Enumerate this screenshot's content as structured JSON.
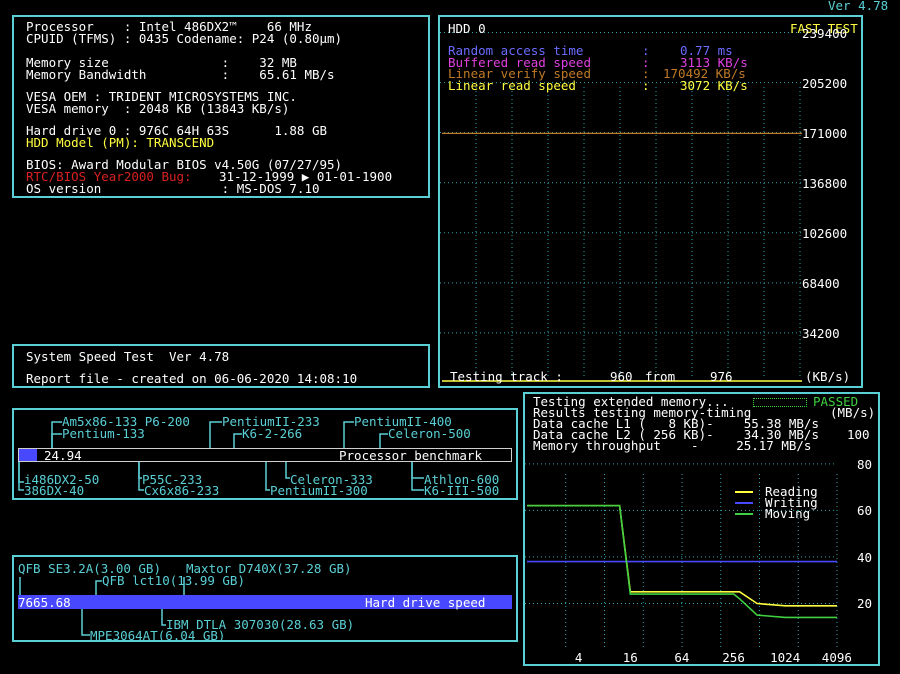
{
  "version": "Ver 4.78",
  "sysinfo": {
    "lines": [
      {
        "text": "Processor    : Intel 486DX2™    66 MHz",
        "color": "w"
      },
      {
        "text": "CPUID (TFMS) : 0435 Codename: P24 (0.80µm)",
        "color": "w"
      },
      {
        "text": "Memory size               :    32 MB",
        "color": "w"
      },
      {
        "text": "Memory Bandwidth          :    65.61 MB/s",
        "color": "w"
      },
      {
        "text": "VESA OEM : TRIDENT MICROSYSTEMS INC.",
        "color": "w"
      },
      {
        "text": "VESA memory  : 2048 KB (13843 KB/s)",
        "color": "w"
      },
      {
        "text": "Hard drive 0 : 976C 64H 63S      1.88 GB",
        "color": "w"
      },
      {
        "text": "HDD Model (PM): TRANSCEND",
        "color": "y"
      },
      {
        "text": "BIOS: Award Modular BIOS v4.50G (07/27/95)",
        "color": "w"
      },
      {
        "text": "31-12-1999 ▶ 01-01-1900",
        "color": "w"
      },
      {
        "text": "RTC/BIOS Year2000 Bug:",
        "color": "r"
      },
      {
        "text": "OS version                : MS-DOS 7.10",
        "color": "w"
      }
    ]
  },
  "systemtest": {
    "title": "System Speed Test  Ver 4.78",
    "report": "Report file - created on 06-06-2020 14:08:10"
  },
  "hdd": {
    "title": "HDD 0",
    "fast_test": "FAST TEST",
    "rows": [
      {
        "label": "Random access time",
        "sep": ":",
        "value": "0.77 ms",
        "color": "b"
      },
      {
        "label": "Buffered read speed",
        "sep": ":",
        "value": "3113 KB/s",
        "color": "m"
      },
      {
        "label": "Linear verify speed",
        "sep": ":",
        "value": "170492 KB/s",
        "color": "o"
      },
      {
        "label": "Linear read speed",
        "sep": ":",
        "value": "3072 KB/s",
        "color": "y"
      }
    ],
    "footer_label": "Testing track :",
    "footer_cur": "960",
    "footer_from": "from",
    "footer_total": "976",
    "footer_unit": "(KB/s)"
  },
  "cpu_bench": {
    "top_labels": [
      "Am5x86-133 P6-200",
      "Pentium-133",
      "PentiumII-233",
      "K6-2-266",
      "PentiumII-400",
      "Celeron-500"
    ],
    "bottom_labels": [
      "i486DX2-50",
      "386DX-40",
      "P55C-233",
      "Cx6x86-233",
      "Celeron-333",
      "PentiumII-300",
      "Athlon-600",
      "K6-III-500"
    ],
    "value": "24.94",
    "bar_label": "Processor benchmark"
  },
  "hdd_bench": {
    "top_labels": [
      "QFB SE3.2A(3.00 GB)",
      "Maxtor D740X(37.28 GB)",
      "QFB lct10(13.99 GB)"
    ],
    "bottom_labels": [
      "IBM DTLA 307030(28.63 GB)",
      "MPE3064AT(6.04 GB)"
    ],
    "value": "7665.68",
    "bar_label": "Hard drive speed"
  },
  "memtest": {
    "line1": "Testing extended memory...",
    "passed": "PASSED",
    "line2": "Results testing memory-timing",
    "unit": "(MB/s)",
    "l1": "Data cache L1 (   8 KB)-    55.38 MB/s",
    "l2": "Data cache L2 ( 256 KB)-    34.30 MB/s",
    "mt": "Memory throughput    -     25.17 MB/s",
    "legend": [
      {
        "name": "Reading",
        "color": "#ffff40"
      },
      {
        "name": "Writing",
        "color": "#4848ff"
      },
      {
        "name": "Moving",
        "color": "#40d040"
      }
    ]
  },
  "chart_data": [
    {
      "type": "line",
      "title": "HDD 0",
      "ylim": [
        0,
        250000
      ],
      "y_ticks": [
        "239400",
        "205200",
        "171000",
        "136800",
        "102600",
        "68400",
        "34200"
      ],
      "series": [
        {
          "name": "Linear verify speed",
          "color": "#c07a28",
          "values": [
            170492,
            170492
          ]
        }
      ]
    },
    {
      "type": "line",
      "xscale": "log2",
      "x_ticks": [
        "4",
        "16",
        "64",
        "256",
        "1024",
        "4096"
      ],
      "y_ticks": [
        "20",
        "40",
        "60",
        "80",
        "100"
      ],
      "ylim": [
        0,
        110
      ],
      "series": [
        {
          "name": "Reading",
          "color": "#ffff40",
          "x": [
            1,
            12,
            16,
            256,
            300,
            480,
            1024,
            4096
          ],
          "values": [
            62,
            62,
            25,
            25,
            25,
            20,
            19,
            19
          ]
        },
        {
          "name": "Writing",
          "color": "#4848ff",
          "x": [
            1,
            4096
          ],
          "values": [
            38,
            38
          ]
        },
        {
          "name": "Moving",
          "color": "#40d040",
          "x": [
            1,
            12,
            16,
            256,
            300,
            480,
            1024,
            4096
          ],
          "values": [
            62,
            62,
            24,
            24,
            22,
            15,
            14,
            14
          ]
        }
      ]
    }
  ]
}
